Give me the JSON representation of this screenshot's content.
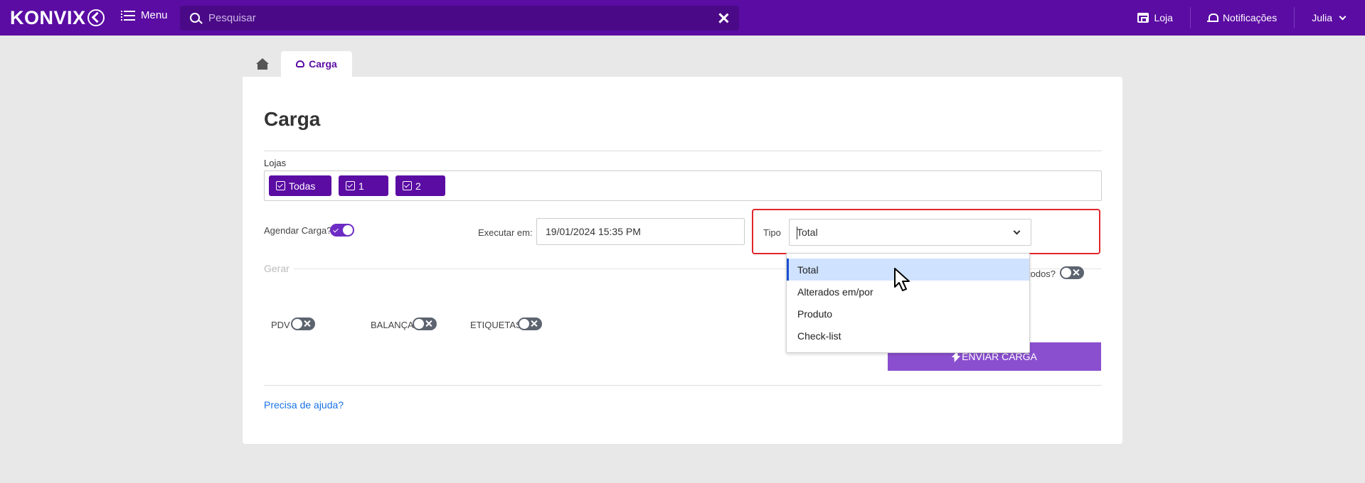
{
  "topbar": {
    "logo_text": "KONVIX",
    "menu_label": "Menu",
    "search_placeholder": "Pesquisar",
    "loja_label": "Loja",
    "notificacoes_label": "Notificações",
    "user_label": "Julia"
  },
  "tabs": [
    {
      "label": "Carga",
      "active": true
    }
  ],
  "page": {
    "title": "Carga",
    "lojas_label": "Lojas",
    "lojas_chips": [
      "Todas",
      "1",
      "2"
    ],
    "agendar_label": "Agendar Carga?",
    "agendar_on": true,
    "executar_label": "Executar em:",
    "executar_value": "19/01/2024 15:35 PM",
    "tipo_label": "Tipo",
    "tipo_value": "Total",
    "gerar_label": "Gerar",
    "todos_label": "todos?",
    "switches": [
      {
        "label": "PDV",
        "on": false
      },
      {
        "label": "BALANÇA",
        "on": false
      },
      {
        "label": "ETIQUETAS",
        "on": false
      }
    ],
    "enviar_label": "ENVIAR CARGA",
    "help_label": "Precisa de ajuda?"
  },
  "dropdown": {
    "options": [
      "Total",
      "Alterados em/por",
      "Produto",
      "Check-list"
    ],
    "selected": "Total"
  },
  "colors": {
    "brand": "#5b0ca3",
    "accent_button": "#8a4fcf",
    "highlight_border": "#e0262b",
    "selected_option": "#cfe2ff",
    "link": "#1a73e8"
  }
}
